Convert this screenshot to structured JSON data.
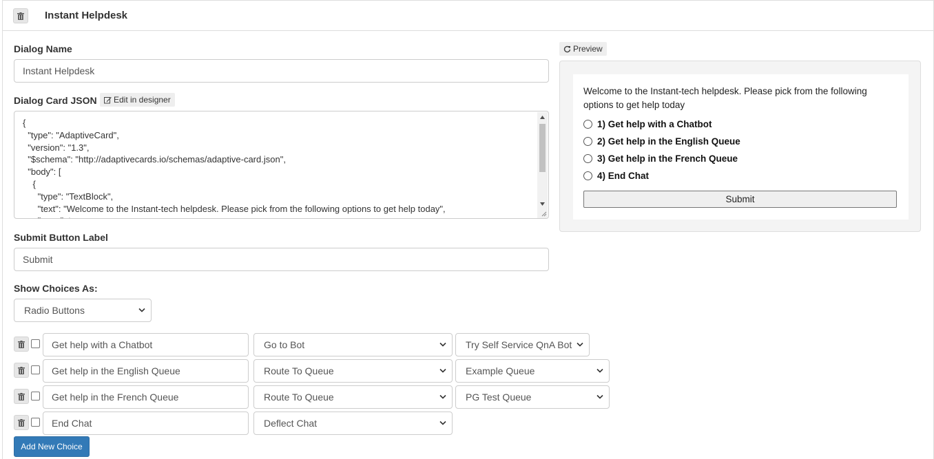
{
  "header": {
    "title": "Instant Helpdesk"
  },
  "form": {
    "dialog_name_label": "Dialog Name",
    "dialog_name_value": "Instant Helpdesk",
    "card_json_label": "Dialog Card JSON",
    "edit_designer_label": "Edit in designer",
    "card_json_lines": [
      "{",
      "  \"type\": \"AdaptiveCard\",",
      "  \"version\": \"1.3\",",
      "  \"$schema\": \"http://adaptivecards.io/schemas/adaptive-card.json\",",
      "  \"body\": [",
      "    {",
      "      \"type\": \"TextBlock\",",
      "      \"text\": \"Welcome to the Instant-tech helpdesk. Please pick from the following options to get help today\",",
      "      \"wrap\": true"
    ],
    "submit_label_label": "Submit Button Label",
    "submit_label_value": "Submit",
    "show_choices_label": "Show Choices As:",
    "show_choices_value": "Radio Buttons"
  },
  "choices": [
    {
      "text": "Get help with a Chatbot",
      "action": "Go to Bot",
      "target": "Try Self Service QnA Bot"
    },
    {
      "text": "Get help in the English Queue",
      "action": "Route To Queue",
      "target": "Example Queue"
    },
    {
      "text": "Get help in the French Queue",
      "action": "Route To Queue",
      "target": "PG Test Queue"
    },
    {
      "text": "End Chat",
      "action": "Deflect Chat",
      "target": null
    }
  ],
  "add_choice_label": "Add New Choice",
  "preview": {
    "button_label": "Preview",
    "intro_text": "Welcome to the Instant-tech helpdesk. Please pick from the following options to get help today",
    "options": [
      "1) Get help with a Chatbot",
      "2) Get help in the English Queue",
      "3) Get help in the French Queue",
      "4) End Chat"
    ],
    "submit_label": "Submit"
  }
}
